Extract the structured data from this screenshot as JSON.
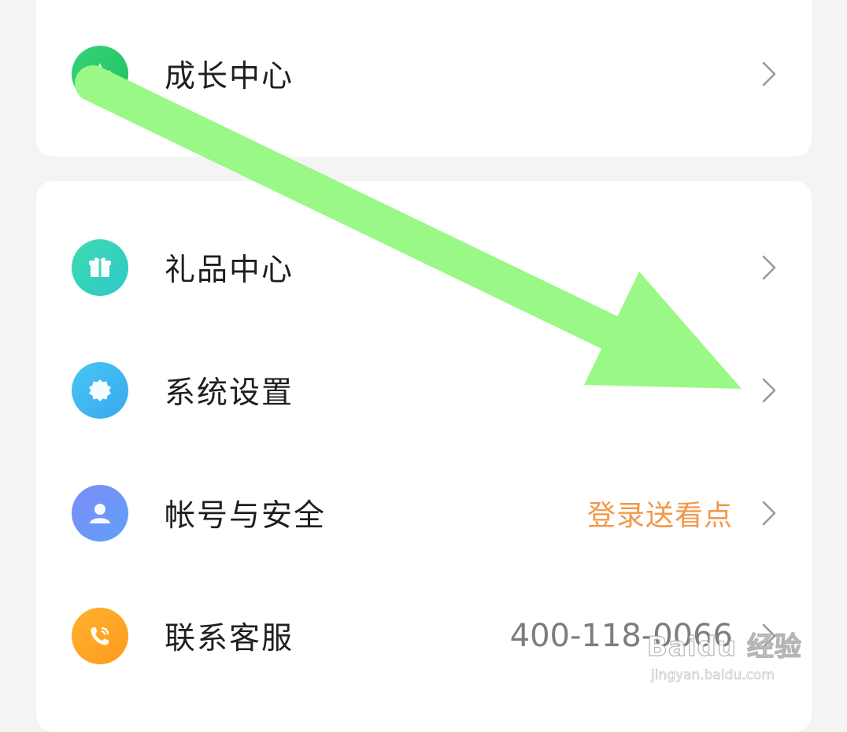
{
  "menu_top": [
    {
      "label": "成长中心",
      "icon": "star-icon",
      "color": "#2ccd6c"
    }
  ],
  "menu_main": [
    {
      "label": "礼品中心",
      "icon": "gift-icon",
      "color": "#35d1bd"
    },
    {
      "label": "系统设置",
      "icon": "gear-icon",
      "color": "#42b8f2"
    },
    {
      "label": "帐号与安全",
      "icon": "user-icon",
      "color": "#6f96f8",
      "value": "登录送看点"
    },
    {
      "label": "联系客服",
      "icon": "phone-icon",
      "color": "#ffa625",
      "value": "400-118-0066"
    }
  ],
  "annotation": {
    "arrow_color": "#99f886"
  },
  "watermark": {
    "logo": "Baidu 经验",
    "url": "jingyan.baidu.com"
  }
}
